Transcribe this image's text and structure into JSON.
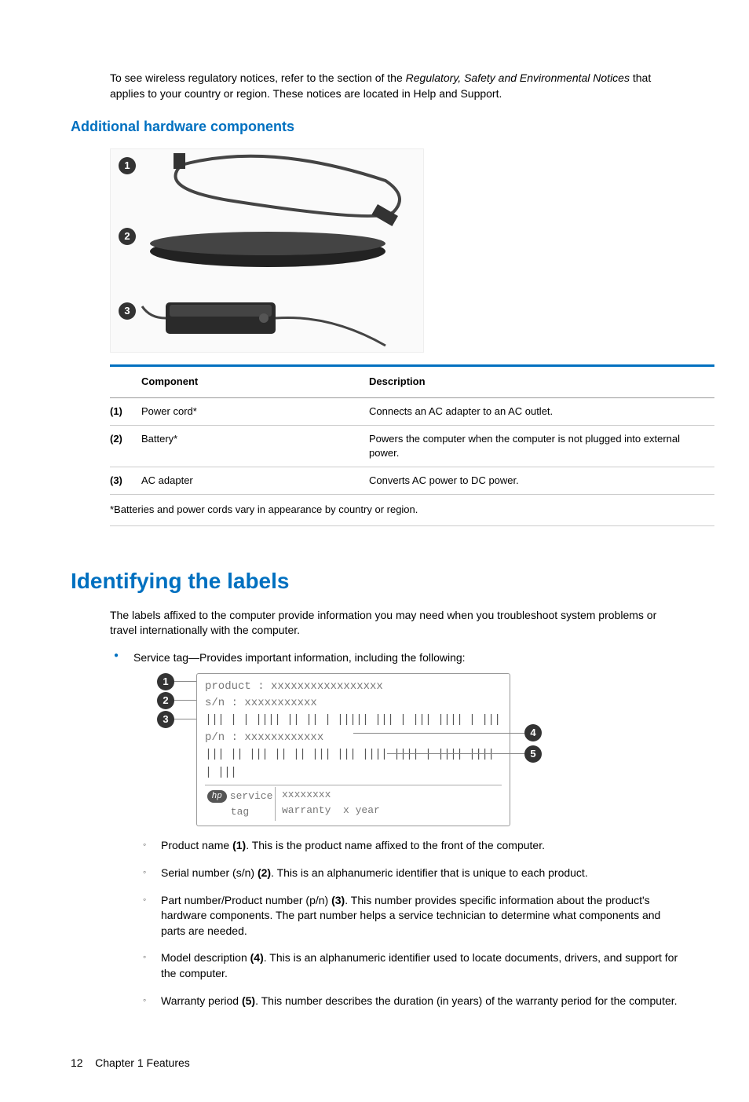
{
  "intro": {
    "part1": "To see wireless regulatory notices, refer to the section of the ",
    "italic": "Regulatory, Safety and Environmental Notices",
    "part2": " that applies to your country or region. These notices are located in Help and Support."
  },
  "section_heading": "Additional hardware components",
  "component_table": {
    "header_component": "Component",
    "header_description": "Description",
    "rows": [
      {
        "num": "(1)",
        "name": "Power cord*",
        "desc": "Connects an AC adapter to an AC outlet."
      },
      {
        "num": "(2)",
        "name": "Battery*",
        "desc": "Powers the computer when the computer is not plugged into external power."
      },
      {
        "num": "(3)",
        "name": "AC adapter",
        "desc": "Converts AC power to DC power."
      }
    ],
    "footnote": "*Batteries and power cords vary in appearance by country or region."
  },
  "major_heading": "Identifying the labels",
  "labels_intro": "The labels affixed to the computer provide information you may need when you troubleshoot system problems or travel internationally with the computer.",
  "bullet_service_tag": "Service tag—Provides important information, including the following:",
  "service_tag": {
    "product_label": "product : xxxxxxxxxxxxxxxxx",
    "sn_label": "s/n : xxxxxxxxxxx",
    "pn_label": "p/n : xxxxxxxxxxxx",
    "service_tag_text1": "service",
    "service_tag_text2": "tag",
    "model_text": "xxxxxxxx",
    "warranty_label": "warranty",
    "warranty_value": "x year",
    "hp_logo": "hp"
  },
  "sub_items": [
    {
      "label": "Product name ",
      "num": "(1)",
      "desc": ". This is the product name affixed to the front of the computer."
    },
    {
      "label": "Serial number (s/n) ",
      "num": "(2)",
      "desc": ". This is an alphanumeric identifier that is unique to each product."
    },
    {
      "label": "Part number/Product number (p/n) ",
      "num": "(3)",
      "desc": ". This number provides specific information about the product's hardware components. The part number helps a service technician to determine what components and parts are needed."
    },
    {
      "label": "Model description ",
      "num": "(4)",
      "desc": ". This is an alphanumeric identifier used to locate documents, drivers, and support for the computer."
    },
    {
      "label": "Warranty period ",
      "num": "(5)",
      "desc": ". This number describes the duration (in years) of the warranty period for the computer."
    }
  ],
  "footer": {
    "page_num": "12",
    "chapter": "Chapter 1   Features"
  },
  "callout_numbers": [
    "1",
    "2",
    "3",
    "4",
    "5"
  ]
}
